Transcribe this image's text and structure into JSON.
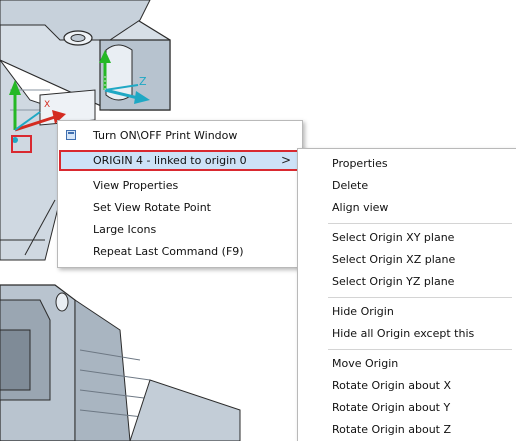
{
  "viewport": {
    "axis_labels": {
      "z": "Z",
      "x": "X"
    }
  },
  "main_menu": {
    "items": [
      {
        "label": "Turn ON\\OFF Print Window",
        "icon": "print-window-icon"
      },
      {
        "label": "ORIGIN 4  - linked to origin 0",
        "submenu_arrow": ">"
      },
      {
        "label": "View Properties"
      },
      {
        "label": "Set View Rotate Point"
      },
      {
        "label": "Large Icons"
      },
      {
        "label": "Repeat Last Command (F9)"
      }
    ]
  },
  "sub_menu": {
    "items": [
      {
        "label": "Properties"
      },
      {
        "label": "Delete"
      },
      {
        "label": "Align view"
      },
      {
        "label": "Select Origin XY plane"
      },
      {
        "label": "Select Origin XZ plane"
      },
      {
        "label": "Select Origin YZ plane"
      },
      {
        "label": "Hide Origin"
      },
      {
        "label": "Hide all Origin except this"
      },
      {
        "label": "Move Origin"
      },
      {
        "label": "Rotate Origin about X"
      },
      {
        "label": "Rotate Origin about Y"
      },
      {
        "label": "Rotate Origin about Z"
      }
    ]
  },
  "colors": {
    "highlight_fill": "#cde2f7",
    "highlight_border": "#d92930",
    "axis_x": "#d42b20",
    "axis_y": "#25b825",
    "axis_z": "#1fa8c4"
  }
}
